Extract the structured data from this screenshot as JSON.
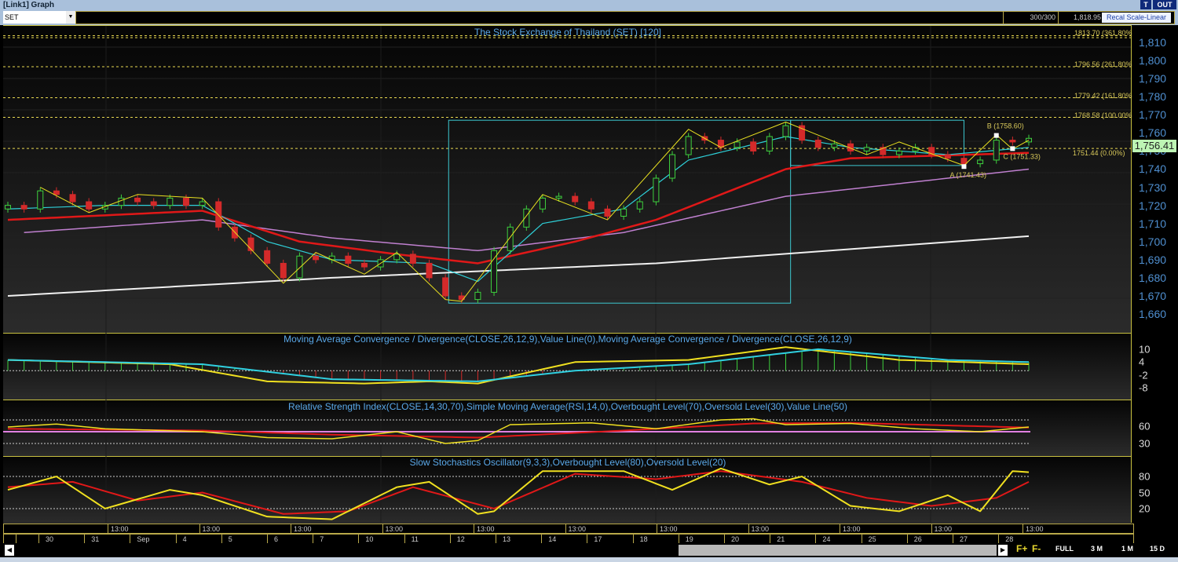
{
  "window": {
    "title": "[Link1] Graph",
    "t_button": "T",
    "out_button": "OUT"
  },
  "toolbar": {
    "symbol": "SET",
    "bars": "300/300",
    "value": "1,818.95",
    "recal_button": "Recal Scale-Linear"
  },
  "main": {
    "title": "The Stock Exchange of Thailand (SET) [120]",
    "current_price": "1,756.41",
    "y_ticks": [
      "1,810",
      "1,800",
      "1,790",
      "1,780",
      "1,770",
      "1,760",
      "1,750",
      "1,740",
      "1,730",
      "1,720",
      "1,710",
      "1,700",
      "1,690",
      "1,680",
      "1,670",
      "1,660"
    ],
    "fib_levels": [
      {
        "price": 1813.7,
        "label": "1813.70 (361.80%"
      },
      {
        "price": 1796.56,
        "label": "1796.56 (261.80%"
      },
      {
        "price": 1779.42,
        "label": "1779.42 (161.80%"
      },
      {
        "price": 1768.58,
        "label": "1768.58 (100.00%"
      },
      {
        "price": 1751.44,
        "label": "1751.44 (0.00%)"
      }
    ],
    "points": [
      {
        "label": "A (1741.43)",
        "price": 1741.43,
        "index": 59
      },
      {
        "label": "B (1758.60)",
        "price": 1758.6,
        "index": 61
      },
      {
        "label": "C (1751.33)",
        "price": 1751.33,
        "index": 62
      }
    ]
  },
  "macd": {
    "title": "Moving Average Convergence / Divergence(CLOSE,26,12,9),Value Line(0),Moving Average Convergence / Divergence(CLOSE,26,12,9)",
    "y_ticks": [
      "10",
      "4",
      "-2",
      "-8"
    ]
  },
  "rsi": {
    "title": "Relative Strength Index(CLOSE,14,30,70),Simple Moving Average(RSI,14,0),Overbought Level(70),Oversold Level(30),Value Line(50)",
    "y_ticks": [
      "60",
      "30"
    ]
  },
  "stoch": {
    "title": "Slow Stochastics Oscillator(9,3,3),Overbought Level(80),Oversold Level(20)",
    "y_ticks": [
      "80",
      "50",
      "20"
    ]
  },
  "x_axis": {
    "time_labels": [
      "13:00",
      "13:00",
      "13:00",
      "13:00",
      "13:00",
      "13:00",
      "13:00",
      "13:00",
      "13:00",
      "13:00",
      "13:00"
    ],
    "dates": [
      "30",
      "31",
      "Sep",
      "4",
      "5",
      "6",
      "7",
      "10",
      "11",
      "12",
      "13",
      "14",
      "17",
      "18",
      "19",
      "20",
      "21",
      "24",
      "25",
      "26",
      "27",
      "28"
    ]
  },
  "zoom_tools": {
    "f_plus": "F+",
    "f_minus": "F-",
    "full": "FULL",
    "3m": "3 M",
    "1m": "1 M",
    "15d": "15 D"
  },
  "colors": {
    "up": "#3ed13e",
    "down": "#d42a2a",
    "ma_short": "#2ed0d8",
    "ma_mid": "#e01818",
    "ma_long": "#c080d0",
    "ma_200": "#f0f0f0",
    "zigzag": "#e8e020",
    "fib": "#e8d850"
  },
  "chart_data": {
    "type": "candlestick",
    "close": [
      1720,
      1718,
      1728,
      1726,
      1722,
      1718,
      1720,
      1724,
      1722,
      1720,
      1724,
      1720,
      1722,
      1708,
      1702,
      1695,
      1688,
      1680,
      1692,
      1690,
      1692,
      1688,
      1686,
      1690,
      1693,
      1688,
      1680,
      1670,
      1668,
      1672,
      1695,
      1708,
      1718,
      1724,
      1725,
      1722,
      1718,
      1714,
      1718,
      1722,
      1735,
      1748,
      1758,
      1756,
      1752,
      1755,
      1750,
      1758,
      1764,
      1756,
      1752,
      1754,
      1750,
      1752,
      1748,
      1750,
      1752,
      1748,
      1746,
      1743,
      1745,
      1756,
      1755,
      1757
    ],
    "ylim": [
      1660,
      1815
    ],
    "ma_short": [
      [
        0,
        1718
      ],
      [
        6,
        1720
      ],
      [
        12,
        1720
      ],
      [
        16,
        1700
      ],
      [
        20,
        1690
      ],
      [
        26,
        1688
      ],
      [
        29,
        1678
      ],
      [
        33,
        1710
      ],
      [
        38,
        1718
      ],
      [
        42,
        1745
      ],
      [
        48,
        1758
      ],
      [
        52,
        1752
      ],
      [
        58,
        1748
      ],
      [
        63,
        1752
      ]
    ],
    "ma_mid": [
      [
        0,
        1712
      ],
      [
        12,
        1717
      ],
      [
        18,
        1700
      ],
      [
        24,
        1693
      ],
      [
        29,
        1688
      ],
      [
        35,
        1700
      ],
      [
        40,
        1712
      ],
      [
        48,
        1740
      ],
      [
        52,
        1746
      ],
      [
        63,
        1749
      ]
    ],
    "ma_long": [
      [
        1,
        1705
      ],
      [
        12,
        1712
      ],
      [
        20,
        1702
      ],
      [
        29,
        1695
      ],
      [
        38,
        1705
      ],
      [
        48,
        1725
      ],
      [
        63,
        1740
      ]
    ],
    "ma_200": [
      [
        0,
        1670
      ],
      [
        20,
        1680
      ],
      [
        40,
        1688
      ],
      [
        63,
        1703
      ]
    ],
    "zigzag": [
      [
        2,
        1730
      ],
      [
        5,
        1716
      ],
      [
        8,
        1726
      ],
      [
        12,
        1724
      ],
      [
        17,
        1677
      ],
      [
        19,
        1694
      ],
      [
        22,
        1682
      ],
      [
        24,
        1694
      ],
      [
        27,
        1668
      ],
      [
        28,
        1667
      ],
      [
        33,
        1726
      ],
      [
        37,
        1712
      ],
      [
        42,
        1762
      ],
      [
        44,
        1752
      ],
      [
        48,
        1766
      ],
      [
        53,
        1748
      ],
      [
        55,
        1755
      ],
      [
        59,
        1742
      ],
      [
        61,
        1759
      ],
      [
        62,
        1751
      ],
      [
        63,
        1756
      ]
    ],
    "boxes": [
      {
        "from": 27.2,
        "to": 48.3,
        "high": 1767,
        "low": 1666
      },
      {
        "from": 48.3,
        "to": 59,
        "high": 1767,
        "low": 1742
      }
    ],
    "macd": {
      "ylim": [
        -12,
        14
      ],
      "macd": [
        [
          0,
          5
        ],
        [
          10,
          3
        ],
        [
          16,
          -5
        ],
        [
          22,
          -6
        ],
        [
          26,
          -5
        ],
        [
          29,
          -6
        ],
        [
          35,
          4
        ],
        [
          42,
          5
        ],
        [
          48,
          11
        ],
        [
          55,
          5
        ],
        [
          63,
          3
        ]
      ],
      "signal": [
        [
          0,
          5
        ],
        [
          12,
          3
        ],
        [
          20,
          -4
        ],
        [
          29,
          -5
        ],
        [
          35,
          0
        ],
        [
          42,
          3
        ],
        [
          50,
          10
        ],
        [
          58,
          5
        ],
        [
          63,
          4
        ]
      ]
    },
    "rsi": {
      "ylim": [
        10,
        90
      ],
      "rsi": [
        [
          0,
          58
        ],
        [
          3,
          63
        ],
        [
          6,
          55
        ],
        [
          12,
          50
        ],
        [
          16,
          40
        ],
        [
          20,
          38
        ],
        [
          24,
          50
        ],
        [
          27,
          30
        ],
        [
          29,
          35
        ],
        [
          31,
          62
        ],
        [
          36,
          65
        ],
        [
          40,
          55
        ],
        [
          44,
          70
        ],
        [
          46,
          72
        ],
        [
          48,
          62
        ],
        [
          52,
          64
        ],
        [
          56,
          55
        ],
        [
          60,
          50
        ],
        [
          63,
          58
        ]
      ],
      "sma": [
        [
          0,
          55
        ],
        [
          12,
          52
        ],
        [
          20,
          45
        ],
        [
          29,
          40
        ],
        [
          38,
          52
        ],
        [
          46,
          64
        ],
        [
          52,
          65
        ],
        [
          63,
          57
        ]
      ],
      "levels": [
        70,
        30,
        50
      ]
    },
    "stoch": {
      "ylim": [
        -5,
        105
      ],
      "k": [
        [
          0,
          55
        ],
        [
          3,
          80
        ],
        [
          6,
          20
        ],
        [
          10,
          55
        ],
        [
          12,
          45
        ],
        [
          16,
          5
        ],
        [
          20,
          0
        ],
        [
          24,
          60
        ],
        [
          26,
          70
        ],
        [
          29,
          10
        ],
        [
          30,
          15
        ],
        [
          33,
          90
        ],
        [
          38,
          90
        ],
        [
          41,
          55
        ],
        [
          44,
          95
        ],
        [
          47,
          65
        ],
        [
          49,
          80
        ],
        [
          52,
          25
        ],
        [
          55,
          15
        ],
        [
          58,
          45
        ],
        [
          60,
          15
        ],
        [
          62,
          90
        ],
        [
          63,
          88
        ]
      ],
      "d": [
        [
          0,
          60
        ],
        [
          4,
          70
        ],
        [
          8,
          35
        ],
        [
          12,
          50
        ],
        [
          17,
          10
        ],
        [
          21,
          15
        ],
        [
          25,
          60
        ],
        [
          30,
          20
        ],
        [
          35,
          85
        ],
        [
          40,
          75
        ],
        [
          44,
          90
        ],
        [
          49,
          70
        ],
        [
          53,
          40
        ],
        [
          57,
          25
        ],
        [
          61,
          40
        ],
        [
          63,
          70
        ]
      ],
      "levels": [
        80,
        20
      ]
    }
  }
}
